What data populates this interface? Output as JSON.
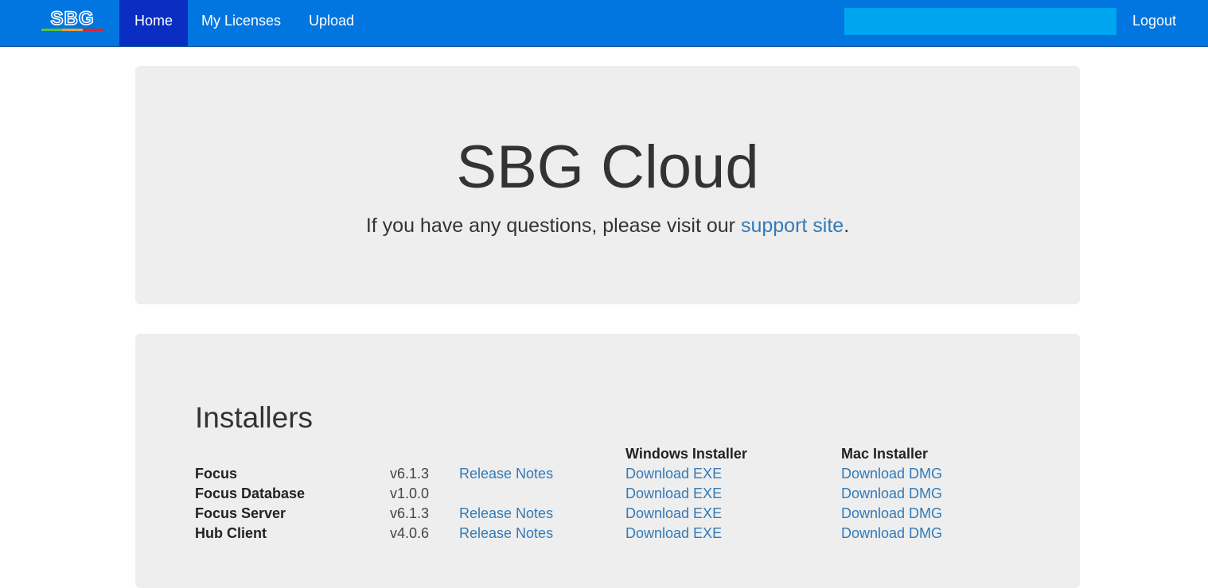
{
  "nav": {
    "brand": "SBG",
    "items": [
      {
        "label": "Home",
        "active": true
      },
      {
        "label": "My Licenses",
        "active": false
      },
      {
        "label": "Upload",
        "active": false
      }
    ],
    "search_value": "",
    "logout_label": "Logout"
  },
  "hero": {
    "title": "SBG Cloud",
    "text_before": "If you have any questions, please visit our ",
    "link_label": "support site",
    "text_after": "."
  },
  "installers": {
    "heading": "Installers",
    "windows_header": "Windows Installer",
    "mac_header": "Mac Installer",
    "rows": [
      {
        "name": "Focus",
        "version": "v6.1.3",
        "notes": "Release Notes",
        "exe": "Download EXE",
        "dmg": "Download DMG"
      },
      {
        "name": "Focus Database",
        "version": "v1.0.0",
        "notes": "",
        "exe": "Download EXE",
        "dmg": "Download DMG"
      },
      {
        "name": "Focus Server",
        "version": "v6.1.3",
        "notes": "Release Notes",
        "exe": "Download EXE",
        "dmg": "Download DMG"
      },
      {
        "name": "Hub Client",
        "version": "v4.0.6",
        "notes": "Release Notes",
        "exe": "Download EXE",
        "dmg": "Download DMG"
      }
    ]
  },
  "colors": {
    "navbar": "#0176e0",
    "nav_active": "#0a2ec2",
    "search_bg": "#00a5ef",
    "link": "#337ab7",
    "panel_bg": "#eeeeee"
  }
}
